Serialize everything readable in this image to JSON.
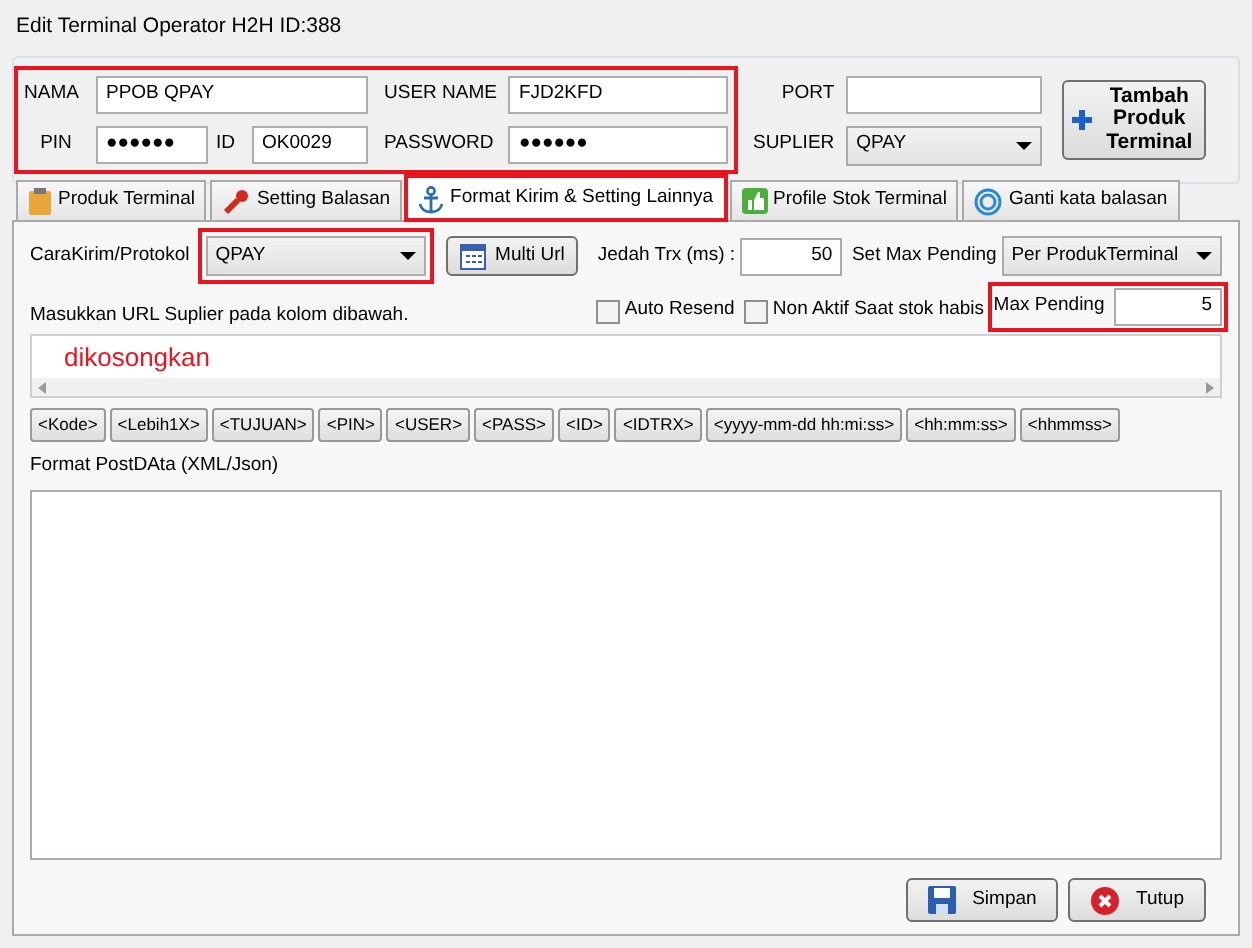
{
  "window": {
    "title": "Edit Terminal Operator H2H ID:388"
  },
  "header": {
    "nama": {
      "label": "NAMA",
      "value": "PPOB QPAY"
    },
    "user_name": {
      "label": "USER NAME",
      "value": "FJD2KFD"
    },
    "pin": {
      "label": "PIN",
      "value": "●●●●●●"
    },
    "id": {
      "label": "ID",
      "value": "OK0029"
    },
    "password": {
      "label": "PASSWORD",
      "value": "●●●●●●"
    },
    "port": {
      "label": "PORT"
    },
    "suplier": {
      "label": "SUPLIER",
      "value": "QPAY"
    },
    "add_button": "Tambah Produk Terminal"
  },
  "tabs": [
    {
      "label": "Produk Terminal",
      "kind": "clipboard",
      "selected": false
    },
    {
      "label": "Setting Balasan",
      "kind": "wrench",
      "selected": false
    },
    {
      "label": "Format Kirim & Setting Lainnya",
      "kind": "anchor",
      "selected": true
    },
    {
      "label": "Profile Stok Terminal",
      "kind": "thumb",
      "selected": false
    },
    {
      "label": "Ganti kata balasan",
      "kind": "ring",
      "selected": false
    }
  ],
  "settings": {
    "protocol": {
      "label": "CaraKirim/Protokol",
      "value": "QPAY"
    },
    "multi_url": "Multi Url",
    "delay": {
      "label": "Jedah Trx (ms) :",
      "value": "50"
    },
    "max_pending_mode": {
      "label": "Set Max Pending",
      "value": "Per ProdukTerminal"
    },
    "checkboxes": [
      {
        "label": "Auto Resend",
        "checked": false
      },
      {
        "label": "Non Aktif Saat stok habis",
        "checked": false
      }
    ],
    "max_pending": {
      "label": "Max Pending",
      "value": "5"
    },
    "url_hint": "Masukkan URL Suplier pada kolom dibawah.",
    "url_value": "dikosongkan",
    "tags": [
      "<Kode>",
      "<Lebih1X>",
      "<TUJUAN>",
      "<PIN>",
      "<USER>",
      "<PASS>",
      "<ID>",
      "<IDTRX>",
      "<yyyy-mm-dd hh:mi:ss>",
      "<hh:mm:ss>",
      "<hhmmss>"
    ],
    "post_label": "Format PostDAta (XML/Json)"
  },
  "buttons": [
    {
      "label": "Simpan",
      "kind": "save"
    },
    {
      "label": "Tutup",
      "kind": "close"
    }
  ]
}
